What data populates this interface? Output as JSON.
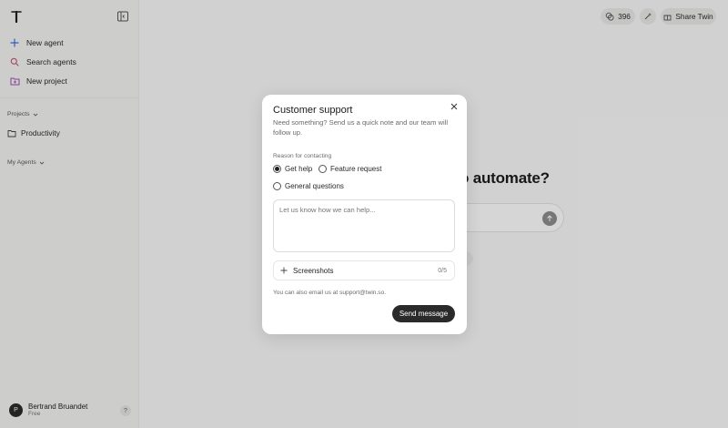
{
  "sidebar": {
    "logo_letter": "T",
    "nav": [
      {
        "label": "New agent",
        "icon": "plus-icon"
      },
      {
        "label": "Search agents",
        "icon": "search-icon"
      },
      {
        "label": "New project",
        "icon": "folder-plus-icon"
      }
    ],
    "projects_label": "Projects",
    "projects": [
      {
        "label": "Productivity",
        "icon": "folder-icon"
      }
    ],
    "agents_label": "My Agents",
    "user": {
      "initial": "P",
      "name": "Bertrand Bruandet",
      "plan": "Free"
    },
    "help_label": "?"
  },
  "topbar": {
    "credits": "396",
    "share_label": "Share Twin"
  },
  "main": {
    "headline_fragment": "o automate?"
  },
  "modal": {
    "title": "Customer support",
    "description": "Need something? Send us a quick note and our team will follow up.",
    "reason_label": "Reason for contacting",
    "options": [
      {
        "label": "Get help",
        "selected": true
      },
      {
        "label": "Feature request",
        "selected": false
      },
      {
        "label": "General questions",
        "selected": false
      }
    ],
    "message_placeholder": "Let us know how we can help...",
    "screenshots_label": "Screenshots",
    "screenshots_count": "0/5",
    "email_note": "You can also email us at support@twin.so.",
    "send_label": "Send message"
  },
  "colors": {
    "primary_button": "#2a2a2a",
    "overlay": "rgba(0,0,0,0.16)",
    "sidebar_bg": "#f5f5f3",
    "search_icon": "#c2566b",
    "new_agent_icon": "#3b6fd8",
    "new_project_icon": "#9c4fb8"
  }
}
